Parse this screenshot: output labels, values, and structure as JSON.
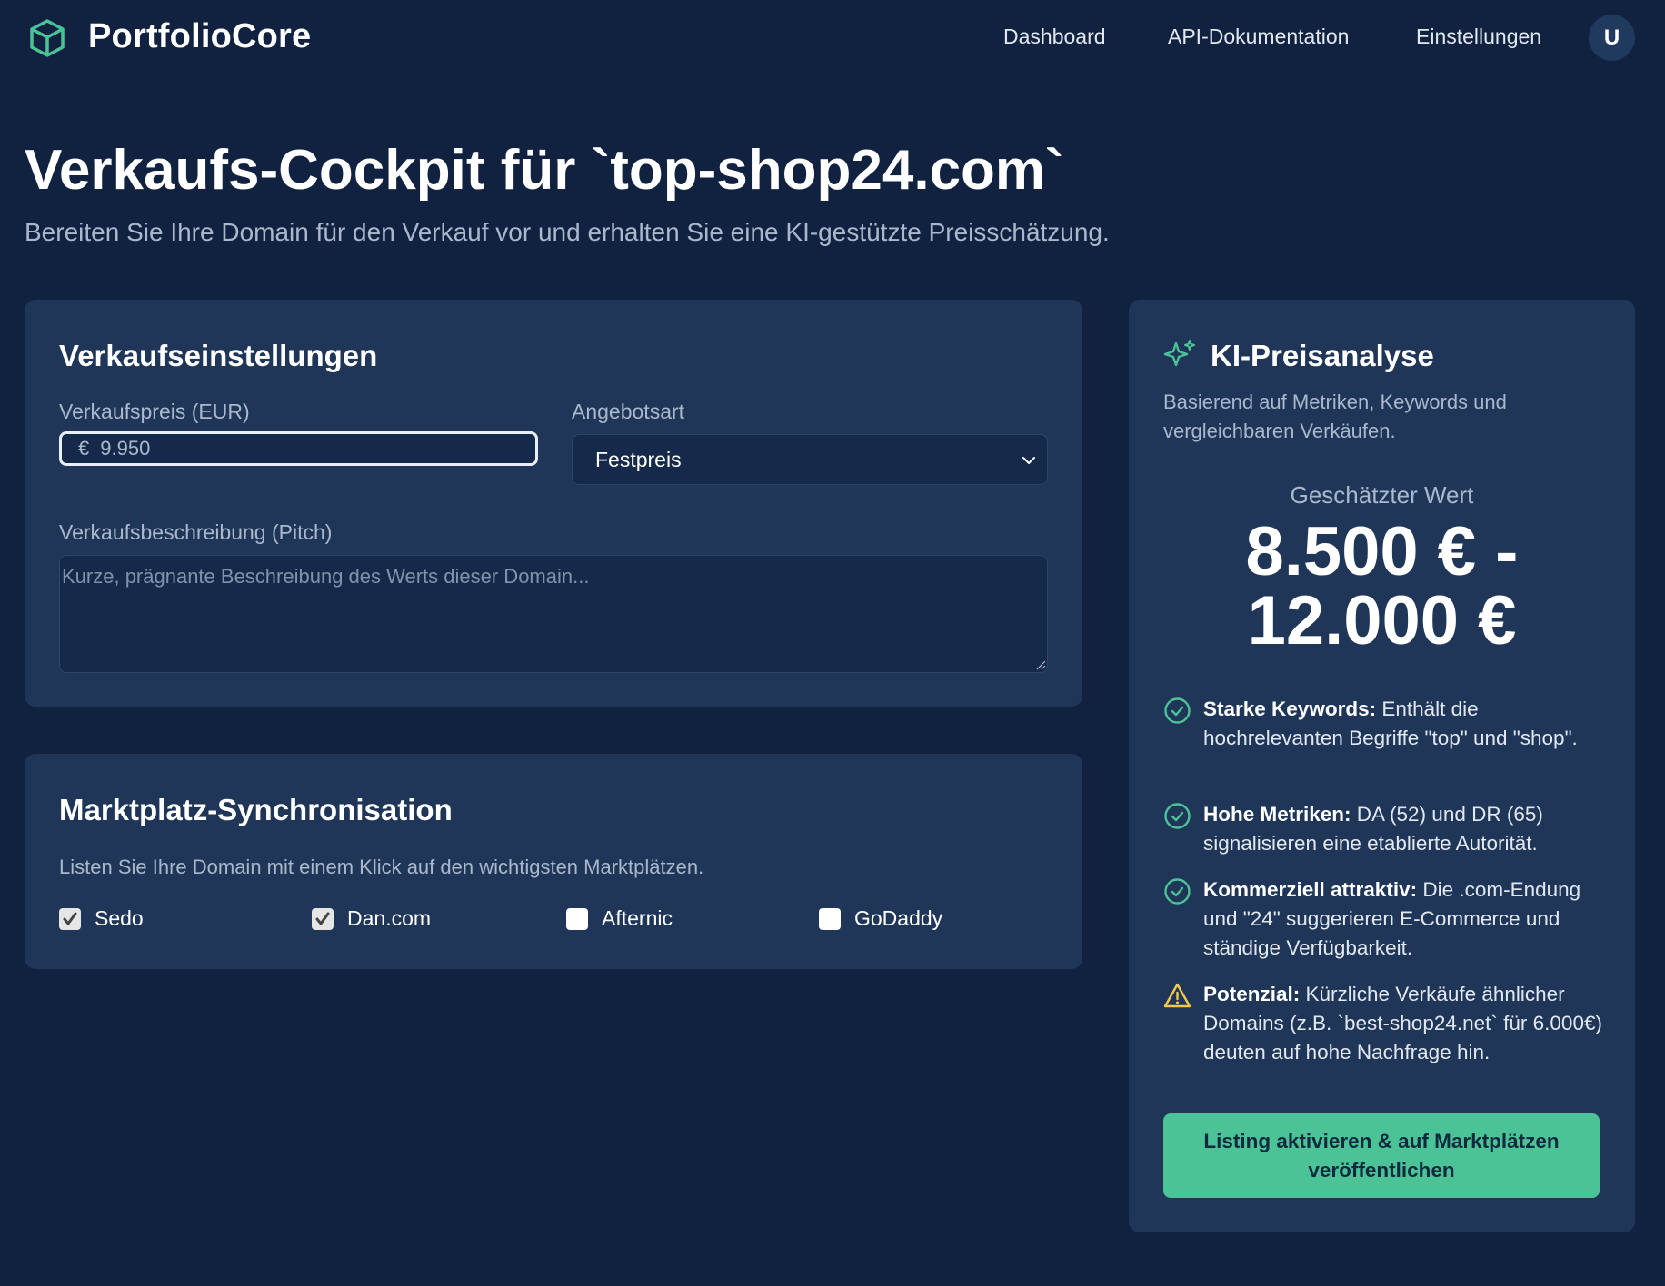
{
  "header": {
    "app_name": "PortfolioCore",
    "nav": [
      "Dashboard",
      "API-Dokumentation",
      "Einstellungen"
    ],
    "avatar_initial": "U",
    "logo_icon": "cube-logo-icon",
    "accent_color": "#4cc297"
  },
  "page": {
    "title": "Verkaufs-Cockpit für `top-shop24.com`",
    "subtitle": "Bereiten Sie Ihre Domain für den Verkauf vor und erhalten Sie eine KI-gestützte Preisschätzung."
  },
  "settings": {
    "title": "Verkaufseinstellungen",
    "price_label": "Verkaufspreis (EUR)",
    "price_currency": "€",
    "price_placeholder": "9.950",
    "offer_type_label": "Angebotsart",
    "offer_type_value": "Festpreis",
    "pitch_label": "Verkaufsbeschreibung (Pitch)",
    "pitch_placeholder": "Kurze, prägnante Beschreibung des Werts dieser Domain..."
  },
  "market": {
    "title": "Marktplatz-Synchronisation",
    "description": "Listen Sie Ihre Domain mit einem Klick auf den wichtigsten Marktplätzen.",
    "platforms": [
      {
        "name": "Sedo",
        "checked": true
      },
      {
        "name": "Dan.com",
        "checked": true
      },
      {
        "name": "Afternic",
        "checked": false
      },
      {
        "name": "GoDaddy",
        "checked": false
      }
    ]
  },
  "ai": {
    "title": "KI-Preisanalyse",
    "description": "Basierend auf Metriken, Keywords und vergleichbaren Verkäufen.",
    "estimate_label": "Geschätzter Wert",
    "estimate_line1": "8.500 € -",
    "estimate_line2": "12.000 €",
    "reasons": [
      {
        "icon": "check-circle-icon",
        "bold": "Starke Keywords:",
        "text": " Enthält die hochrelevanten Begriffe \"top\" und \"shop\"."
      },
      {
        "icon": "check-circle-icon",
        "bold": "Hohe Metriken:",
        "text": " DA (52) und DR (65) signalisieren eine etablierte Autorität."
      },
      {
        "icon": "check-circle-icon",
        "bold": "Kommerziell attraktiv:",
        "text": " Die .com-Endung und \"24\" suggerieren E-Commerce und ständige Verfügbarkeit."
      },
      {
        "icon": "warning-triangle-icon",
        "bold": "Potenzial:",
        "text": " Kürzliche Verkäufe ähnlicher Domains (z.B. `best-shop24.net` für 6.000€) deuten auf hohe Nachfrage hin."
      }
    ],
    "cta_label": "Listing aktivieren & auf Marktplätzen veröffentlichen",
    "success_color": "#4cc297",
    "warning_color": "#f2c94c"
  }
}
